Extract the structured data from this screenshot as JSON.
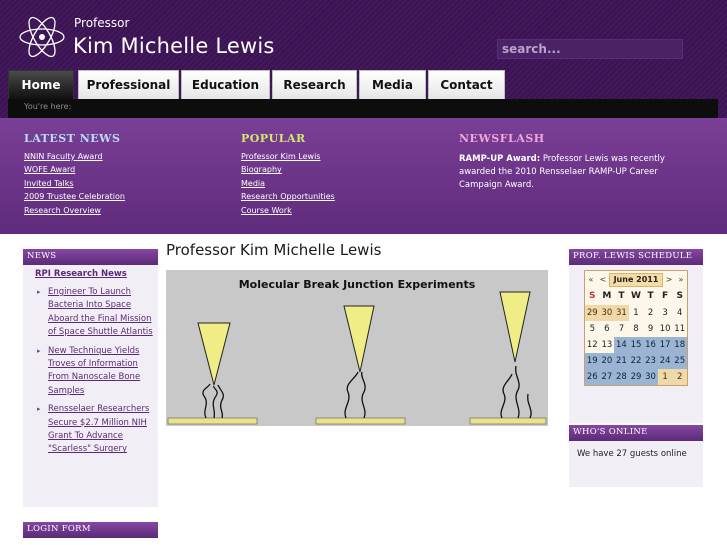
{
  "header": {
    "subtitle": "Professor",
    "title": "Kim Michelle Lewis",
    "search_placeholder": "search..."
  },
  "nav": {
    "tabs": [
      "Home",
      "Professional",
      "Education",
      "Research",
      "Media",
      "Contact"
    ],
    "active": "Home"
  },
  "breadcrumb": "You're here:",
  "band": {
    "latest_news": {
      "heading": "LATEST NEWS",
      "items": [
        "NNIN Faculty Award",
        "WOFE Award",
        "Invited Talks",
        "2009 Trustee Celebration",
        "Research Overview"
      ]
    },
    "popular": {
      "heading": "POPULAR",
      "items": [
        "Professor Kim Lewis",
        "Biography",
        "Media",
        "Research Opportunities",
        "Course Work"
      ]
    },
    "newsflash": {
      "heading": "NEWSFLASH",
      "bold": "RAMP-UP Award:",
      "text": " Professor Lewis was recently awarded the 2010 Rensselaer RAMP-UP Career Campaign Award."
    },
    "colors": {
      "latest": "#b9dcf2",
      "popular": "#d6e86b",
      "newsflash": "#f0a6d8"
    }
  },
  "news": {
    "heading": "NEWS",
    "source": "RPI Research News",
    "items": [
      "Engineer To Launch Bacteria Into Space Aboard the Final Mission of Space Shuttle Atlantis",
      "New Technique Yields Troves of Information From Nanoscale Bone Samples",
      "Rensselaer Researchers Secure $2.7 Million NIH Grant To Advance \"Scarless\" Surgery"
    ]
  },
  "login": {
    "heading": "LOGIN FORM"
  },
  "main": {
    "title": "Professor Kim Michelle Lewis",
    "diagram_title": "Molecular Break Junction Experiments"
  },
  "schedule": {
    "heading": "PROF. LEWIS SCHEDULE",
    "month": "June 2011",
    "nav": [
      "«",
      "<",
      ">",
      "»"
    ],
    "weekdays": [
      "S",
      "M",
      "T",
      "W",
      "T",
      "F",
      "S"
    ],
    "weeks": [
      [
        {
          "d": "29",
          "k": "other"
        },
        {
          "d": "30",
          "k": "other"
        },
        {
          "d": "31",
          "k": "other"
        },
        {
          "d": "1",
          "k": "past"
        },
        {
          "d": "2",
          "k": "past"
        },
        {
          "d": "3",
          "k": "past"
        },
        {
          "d": "4",
          "k": "past"
        }
      ],
      [
        {
          "d": "5",
          "k": "past"
        },
        {
          "d": "6",
          "k": "past"
        },
        {
          "d": "7",
          "k": "past"
        },
        {
          "d": "8",
          "k": "past"
        },
        {
          "d": "9",
          "k": "past"
        },
        {
          "d": "10",
          "k": "past"
        },
        {
          "d": "11",
          "k": "past"
        }
      ],
      [
        {
          "d": "12",
          "k": "past"
        },
        {
          "d": "13",
          "k": "past"
        },
        {
          "d": "14",
          "k": "future"
        },
        {
          "d": "15",
          "k": "future"
        },
        {
          "d": "16",
          "k": "future"
        },
        {
          "d": "17",
          "k": "future"
        },
        {
          "d": "18",
          "k": "future"
        }
      ],
      [
        {
          "d": "19",
          "k": "future"
        },
        {
          "d": "20",
          "k": "future"
        },
        {
          "d": "21",
          "k": "future"
        },
        {
          "d": "22",
          "k": "future"
        },
        {
          "d": "23",
          "k": "future"
        },
        {
          "d": "24",
          "k": "future"
        },
        {
          "d": "25",
          "k": "future"
        }
      ],
      [
        {
          "d": "26",
          "k": "future"
        },
        {
          "d": "27",
          "k": "future"
        },
        {
          "d": "28",
          "k": "future"
        },
        {
          "d": "29",
          "k": "future"
        },
        {
          "d": "30",
          "k": "future"
        },
        {
          "d": "1",
          "k": "other"
        },
        {
          "d": "2",
          "k": "other"
        }
      ]
    ]
  },
  "online": {
    "heading": "WHO'S ONLINE",
    "text": "We have 27 guests online"
  }
}
